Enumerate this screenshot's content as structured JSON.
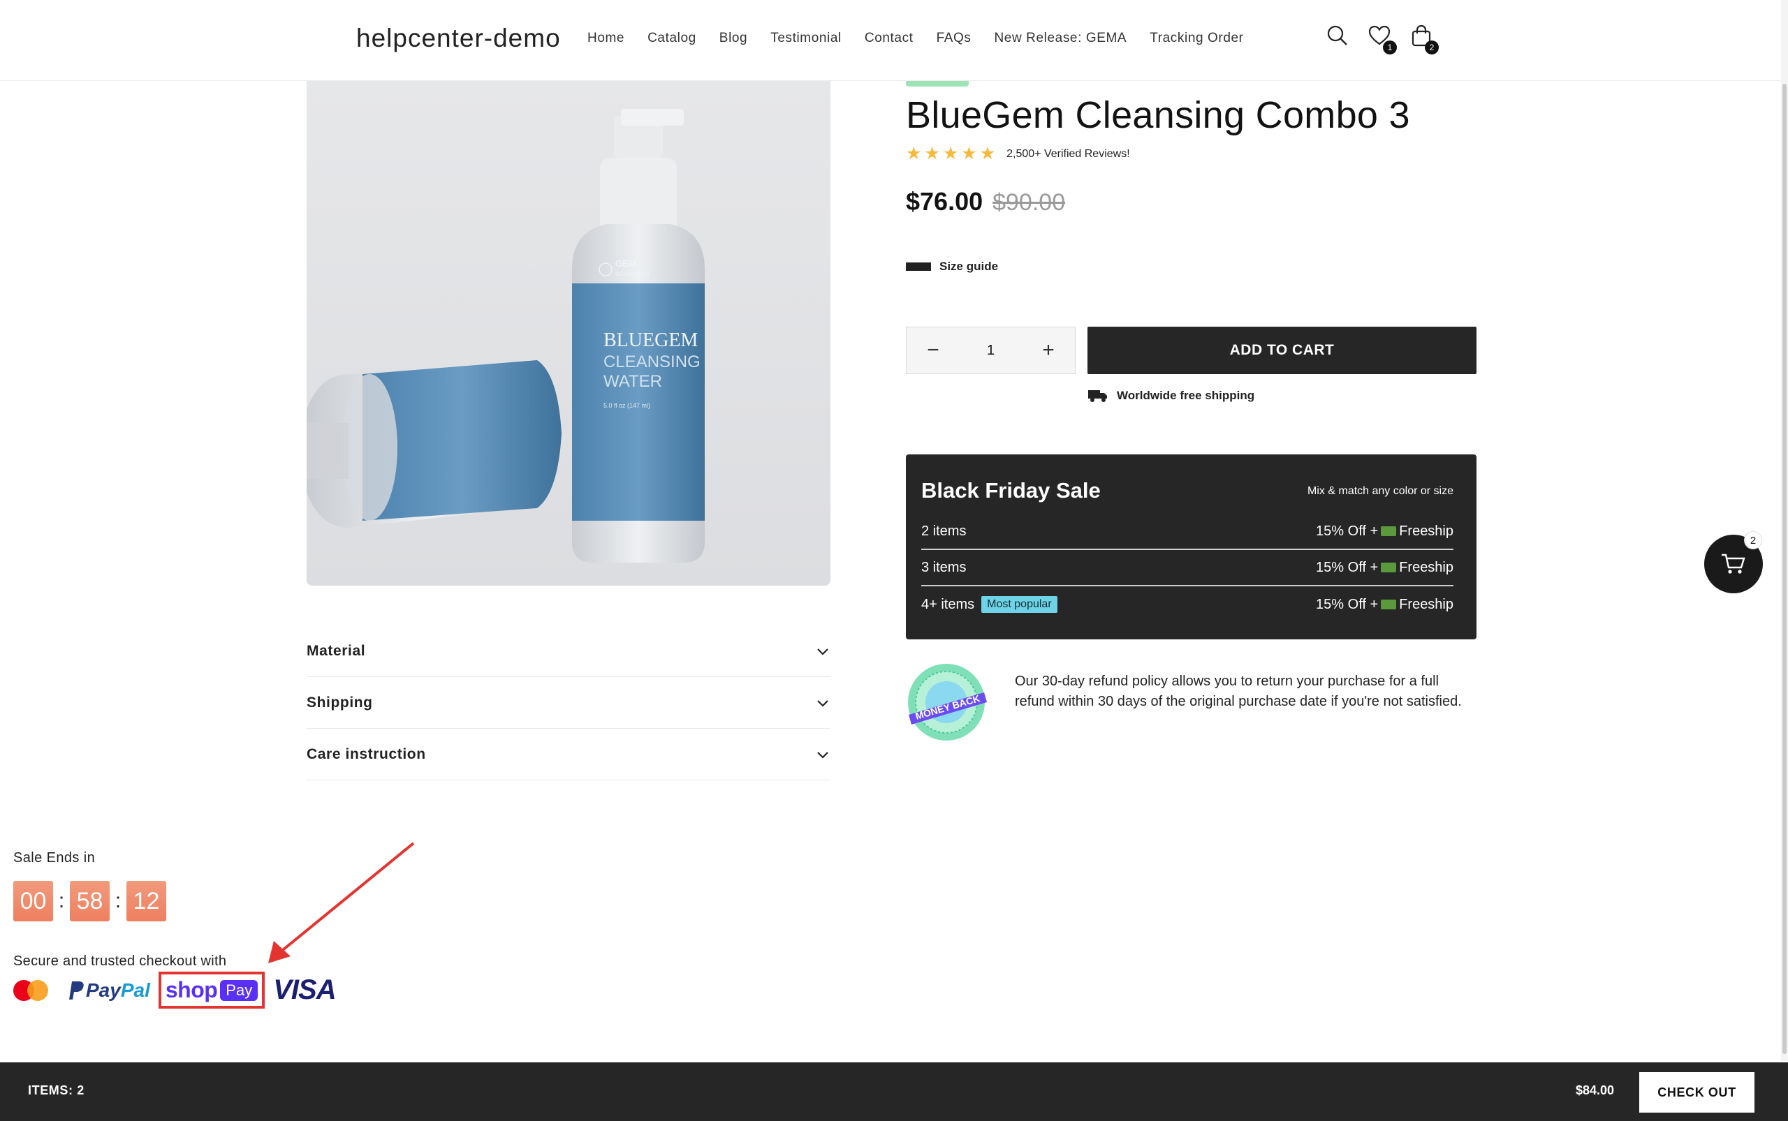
{
  "header": {
    "logo": "helpcenter-demo",
    "nav": [
      "Home",
      "Catalog",
      "Blog",
      "Testimonial",
      "Contact",
      "FAQs",
      "New Release: GEMA",
      "Tracking Order"
    ],
    "wishlist_count": "1",
    "cart_count": "2",
    "icons": [
      "search-icon",
      "heart-icon",
      "bag-icon"
    ]
  },
  "product": {
    "image_label": {
      "brand_top": "GEM",
      "brand_sub": "cosmetics",
      "line1": "BLUEGEM",
      "line2": "CLEANSING",
      "line3": "WATER",
      "volume": "5.0 fl oz (147 ml)"
    },
    "title": "BlueGem Cleansing Combo 3",
    "rating_stars": 5,
    "reviews": "2,500+ Verified Reviews!",
    "price_now": "$76.00",
    "price_was": "$90.00",
    "size_guide": "Size guide",
    "quantity": "1",
    "qty_minus": "−",
    "qty_plus": "+",
    "add_to_cart": "ADD TO CART",
    "shipping_note": "Worldwide free shipping"
  },
  "accordions": [
    "Material",
    "Shipping",
    "Care instruction"
  ],
  "black_friday": {
    "title": "Black Friday Sale",
    "subtitle": "Mix & match any color or size",
    "rows": [
      {
        "items": "2 items",
        "offer_pre": "15% Off +",
        "offer_post": "Freeship"
      },
      {
        "items": "3 items",
        "offer_pre": "15% Off +",
        "offer_post": "Freeship"
      },
      {
        "items": "4+ items",
        "tag": "Most popular",
        "offer_pre": "15% Off +",
        "offer_post": "Freeship"
      }
    ]
  },
  "money_back": {
    "seal_text": "MONEY BACK",
    "text": "Our 30-day refund policy allows you to return your purchase for a full refund within 30 days of the original purchase date if you're not satisfied."
  },
  "countdown": {
    "label": "Sale Ends in",
    "hours": "00",
    "minutes": "58",
    "seconds": "12"
  },
  "checkout_trust": {
    "label": "Secure and trusted checkout with",
    "paypal_a": "Pay",
    "paypal_b": "Pal",
    "shop": "shop",
    "pay": "Pay",
    "visa": "VISA"
  },
  "floating_cart": {
    "count": "2"
  },
  "bottom_bar": {
    "items": "ITEMS: 2",
    "total": "$84.00",
    "checkout": "CHECK OUT"
  },
  "colors": {
    "accent_dark": "#262626",
    "star": "#f6b93b",
    "timer": "#ef7f5f",
    "shoppay": "#5a31f4",
    "highlight": "#e3342f"
  }
}
